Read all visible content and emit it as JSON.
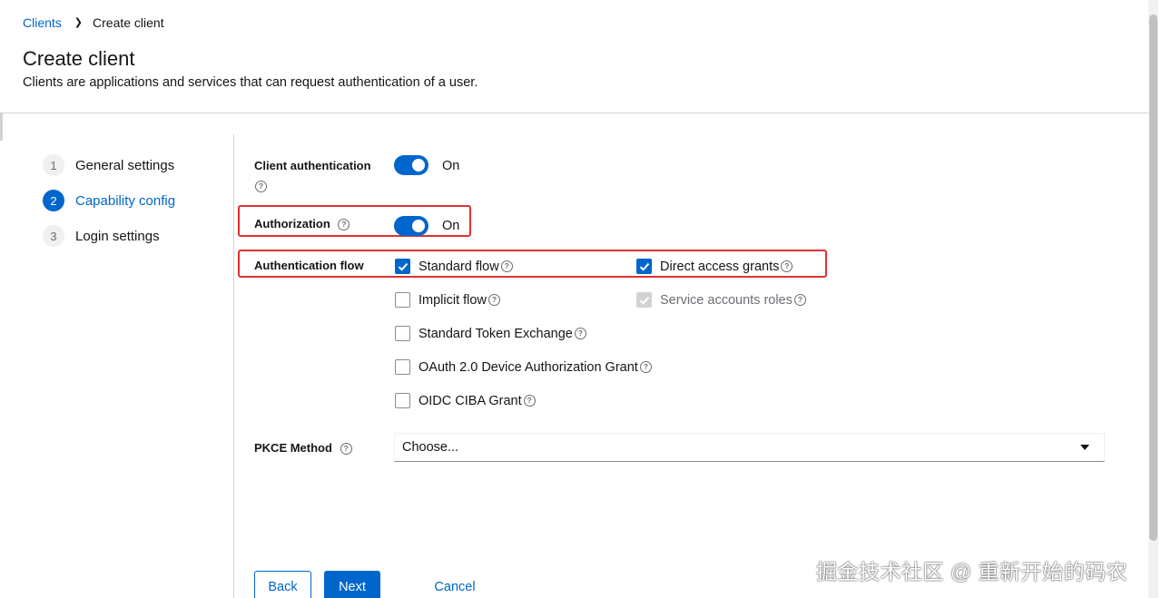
{
  "breadcrumb": {
    "parent": "Clients",
    "current": "Create client"
  },
  "header": {
    "title": "Create client",
    "subtitle": "Clients are applications and services that can request authentication of a user."
  },
  "wizard": {
    "steps": [
      {
        "num": "1",
        "label": "General settings"
      },
      {
        "num": "2",
        "label": "Capability config"
      },
      {
        "num": "3",
        "label": "Login settings"
      }
    ],
    "active_step": 2
  },
  "form": {
    "client_authentication": {
      "label": "Client authentication",
      "state": "On"
    },
    "authorization": {
      "label": "Authorization",
      "state": "On"
    },
    "authentication_flow": {
      "label": "Authentication flow",
      "options": [
        {
          "label": "Standard flow",
          "checked": true,
          "disabled": false
        },
        {
          "label": "Direct access grants",
          "checked": true,
          "disabled": false
        },
        {
          "label": "Implicit flow",
          "checked": false,
          "disabled": false
        },
        {
          "label": "Service accounts roles",
          "checked": true,
          "disabled": true
        },
        {
          "label": "Standard Token Exchange",
          "checked": false,
          "disabled": false
        },
        {
          "label": "OAuth 2.0 Device Authorization Grant",
          "checked": false,
          "disabled": false
        },
        {
          "label": "OIDC CIBA Grant",
          "checked": false,
          "disabled": false
        }
      ]
    },
    "pkce_method": {
      "label": "PKCE Method",
      "placeholder": "Choose..."
    }
  },
  "footer": {
    "back": "Back",
    "next": "Next",
    "cancel": "Cancel"
  },
  "watermark": "掘金技术社区 @ 重新开始的码农",
  "colors": {
    "accent": "#0066cc",
    "highlight": "#e03131",
    "text": "#151515",
    "muted": "#6a6e73"
  }
}
